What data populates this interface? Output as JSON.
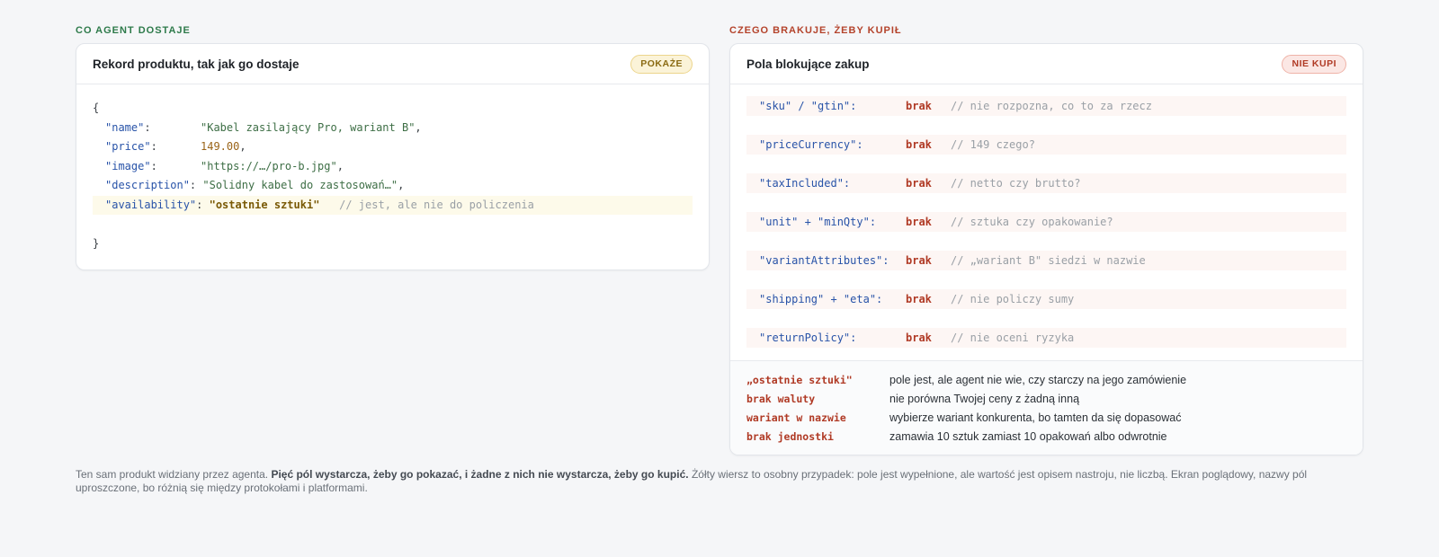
{
  "left": {
    "eyebrow": "CO AGENT DOSTAJE",
    "card_title": "Rekord produktu, tak jak go dostaje",
    "badge": "POKAŻE",
    "code": {
      "open": "{",
      "close": "}",
      "lines": [
        {
          "key": "\"name\"",
          "value": "\"Kabel zasilający Pro, wariant B\"",
          "trail": ","
        },
        {
          "key": "\"price\"",
          "value": "149.00",
          "trail": ","
        },
        {
          "key": "\"image\"",
          "value": "\"https://…/pro-b.jpg\"",
          "trail": ","
        },
        {
          "key": "\"description\"",
          "value": "\"Solidny kabel do zastosowań…\"",
          "trail": ","
        },
        {
          "key": "\"availability\"",
          "value": "\"ostatnie sztuki\"",
          "comment": "// jest, ale nie do policzenia"
        }
      ]
    }
  },
  "right": {
    "eyebrow": "CZEGO BRAKUJE, ŻEBY KUPIŁ",
    "card_title": "Pola blokujące zakup",
    "badge": "NIE KUPI",
    "missing": [
      {
        "key": "\"sku\" / \"gtin\":",
        "status": "brak",
        "comment": "// nie rozpozna, co to za rzecz"
      },
      {
        "key": "\"priceCurrency\":",
        "status": "brak",
        "comment": "// 149 czego?"
      },
      {
        "key": "\"taxIncluded\":",
        "status": "brak",
        "comment": "// netto czy brutto?"
      },
      {
        "key": "\"unit\" + \"minQty\":",
        "status": "brak",
        "comment": "// sztuka czy opakowanie?"
      },
      {
        "key": "\"variantAttributes\":",
        "status": "brak",
        "comment": "// „wariant B\" siedzi w nazwie"
      },
      {
        "key": "\"shipping\" + \"eta\":",
        "status": "brak",
        "comment": "// nie policzy sumy"
      },
      {
        "key": "\"returnPolicy\":",
        "status": "brak",
        "comment": "// nie oceni ryzyka"
      }
    ],
    "legend": [
      {
        "term": "„ostatnie sztuki\"",
        "desc": "pole jest, ale agent nie wie, czy starczy na jego zamówienie"
      },
      {
        "term": "brak waluty",
        "desc": "nie porówna Twojej ceny z żadną inną"
      },
      {
        "term": "wariant w nazwie",
        "desc": "wybierze wariant konkurenta, bo tamten da się dopasować"
      },
      {
        "term": "brak jednostki",
        "desc": "zamawia 10 sztuk zamiast 10 opakowań albo odwrotnie"
      }
    ]
  },
  "footnote": {
    "lead": "Ten sam produkt widziany przez agenta. ",
    "emphasis": "Pięć pól wystarcza, żeby go pokazać, i żadne z nich nie wystarcza, żeby go kupić.",
    "rest": " Żółty wiersz to osobny przypadek: pole jest wypełnione, ale wartość jest opisem nastroju, nie liczbą. Ekran poglądowy, nazwy pól uproszczone, bo różnią się między protokołami i platformami."
  }
}
